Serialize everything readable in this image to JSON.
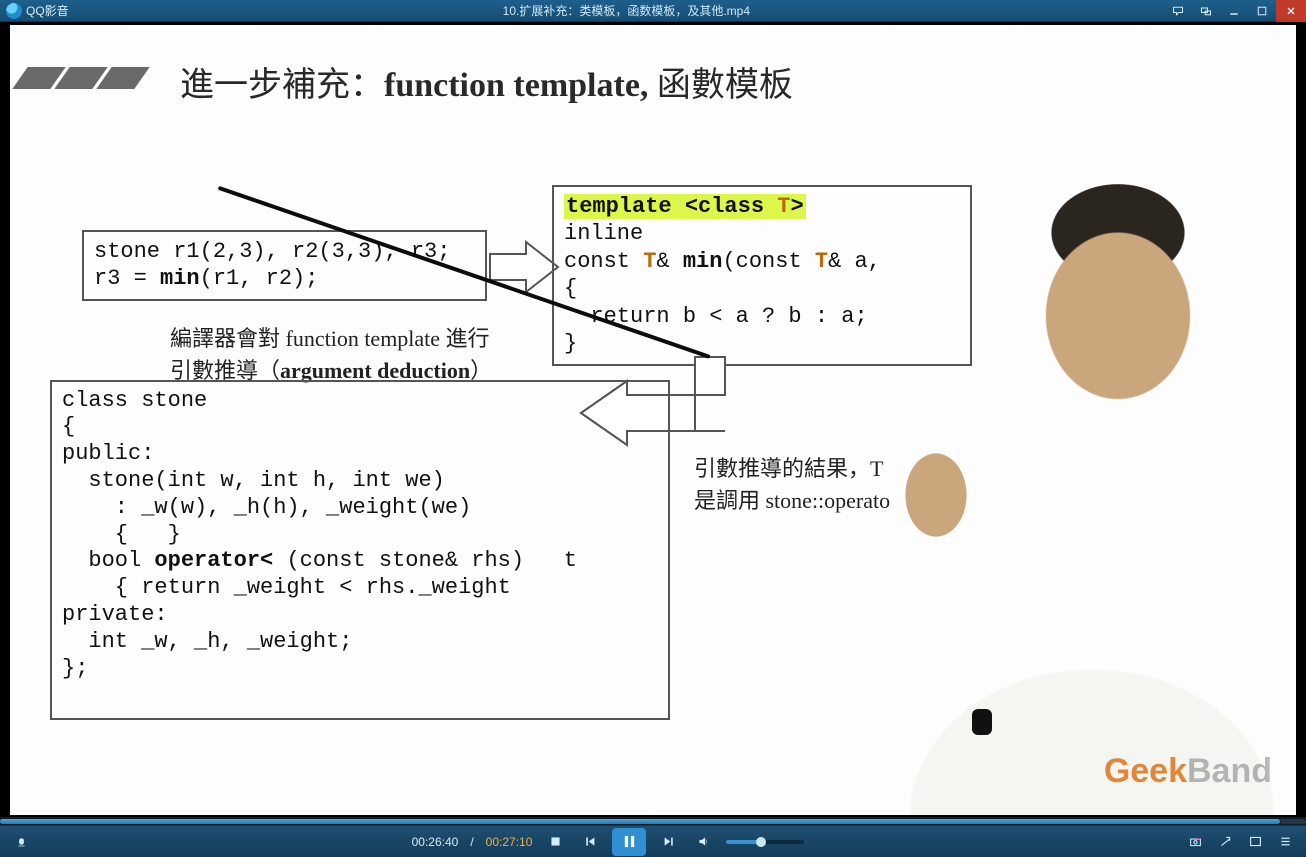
{
  "app": {
    "name": "QQ影音"
  },
  "file": {
    "title": "10.扩展补充：类模板，函数模板，及其他.mp4"
  },
  "slide": {
    "title_prefix": "進一步補充：",
    "title_bold": "function template, ",
    "title_suffix": "函數模板",
    "box1_line1": "stone r1(2,3), r2(3,3), r3;",
    "box1_line2a": "r3 = ",
    "box1_line2b": "min",
    "box1_line2c": "(r1, r2);",
    "annot1_line1": "編譯器會對 function template 進行",
    "annot1_line2a": "引數推導（",
    "annot1_line2b": "argument deduction",
    "annot1_line2c": "）",
    "box2_hl_a": "template <class ",
    "box2_hl_b": "T",
    "box2_hl_c": ">",
    "box2_l2": "inline",
    "box2_l3a": "const ",
    "box2_l3b": "T",
    "box2_l3c": "& ",
    "box2_l3d": "min",
    "box2_l3e": "(const ",
    "box2_l3f": "T",
    "box2_l3g": "& a,",
    "box2_l4": "{",
    "box2_l5": "  return b < a ? b : a;",
    "box2_l6": "}",
    "annot2_line1": "引數推導的結果，T",
    "annot2_line2": "是調用 stone::operato",
    "box3_l1": "class stone",
    "box3_l2": "{",
    "box3_l3": "public:",
    "box3_l4": "  stone(int w, int h, int we)",
    "box3_l5": "    : _w(w), _h(h), _weight(we)",
    "box3_l6": "    {   }",
    "box3_l7a": "  bool ",
    "box3_l7b": "operator<",
    "box3_l7c": " (const stone& rhs)   t",
    "box3_l8": "    { return _weight < rhs._weight",
    "box3_l9": "private:",
    "box3_l10": "  int _w, _h, _weight;",
    "box3_l11": "};",
    "watermark_a": "Geek",
    "watermark_b": "Band"
  },
  "playback": {
    "current": "00:26:40",
    "duration": "00:27:10",
    "progress_pct": 98,
    "volume_pct": 45
  }
}
